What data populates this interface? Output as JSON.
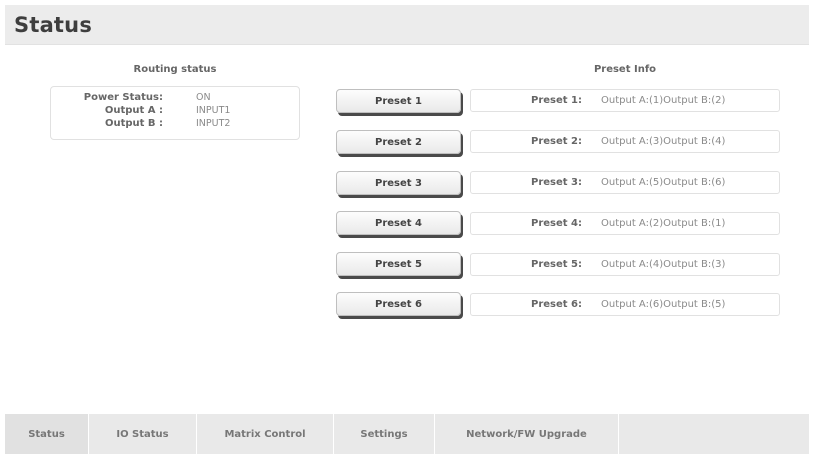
{
  "header": {
    "title": "Status"
  },
  "routing": {
    "heading": "Routing status",
    "rows": [
      {
        "label": "Power Status:",
        "value": "ON"
      },
      {
        "label": "Output A :",
        "value": "INPUT1"
      },
      {
        "label": "Output B :",
        "value": "INPUT2"
      }
    ]
  },
  "preset_info": {
    "heading": "Preset Info",
    "buttons": [
      "Preset 1",
      "Preset 2",
      "Preset 3",
      "Preset 4",
      "Preset 5",
      "Preset 6"
    ],
    "items": [
      {
        "label": "Preset 1:",
        "value": "Output A:(1)Output B:(2)"
      },
      {
        "label": "Preset 2:",
        "value": "Output A:(3)Output B:(4)"
      },
      {
        "label": "Preset 3:",
        "value": "Output A:(5)Output B:(6)"
      },
      {
        "label": "Preset 4:",
        "value": "Output A:(2)Output B:(1)"
      },
      {
        "label": "Preset 5:",
        "value": "Output A:(4)Output B:(3)"
      },
      {
        "label": "Preset 6:",
        "value": "Output A:(6)Output B:(5)"
      }
    ]
  },
  "tabs": [
    {
      "label": "Status",
      "active": true
    },
    {
      "label": "IO Status",
      "active": false
    },
    {
      "label": "Matrix Control",
      "active": false
    },
    {
      "label": "Settings",
      "active": false
    },
    {
      "label": "Network/FW Upgrade",
      "active": false
    }
  ],
  "colors": {
    "tab_bar": "#e9e9e9",
    "title_bar": "#ececec",
    "button_shadow": "#4a4a4a"
  }
}
